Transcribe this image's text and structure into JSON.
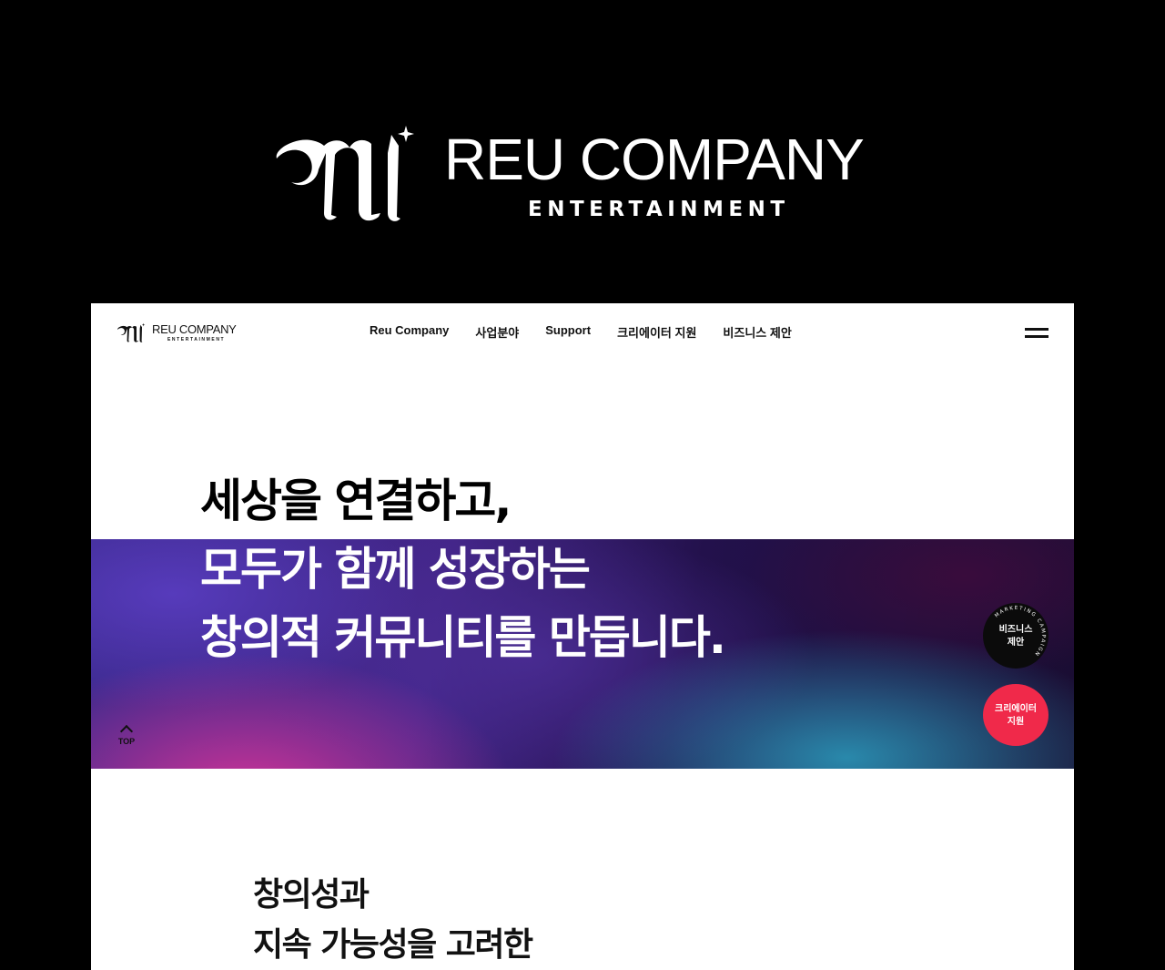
{
  "brand": {
    "monogram": "Rl",
    "name": "REU COMPANY",
    "tagline": "ENTERTAINMENT"
  },
  "nav": {
    "logo": {
      "name": "REU COMPANY",
      "tagline": "ENTERTAINMENT"
    },
    "menu": [
      {
        "label": "Reu Company"
      },
      {
        "label": "사업분야"
      },
      {
        "label": "Support"
      },
      {
        "label": "크리에이터 지원"
      },
      {
        "label": "비즈니스 제안"
      }
    ],
    "menu_icon": "hamburger-icon"
  },
  "hero": {
    "line1": "세상을 연결하고,",
    "line2": "모두가 함께 성장하는",
    "line3": "창의적 커뮤니티를 만듭니다."
  },
  "floating": {
    "business_badge": {
      "label_line1": "비즈니스",
      "label_line2": "제안",
      "ring_text": "MARKETING CAMPAIGN"
    },
    "creator_badge": {
      "label_line1": "크리에이터",
      "label_line2": "지원"
    },
    "top_button": {
      "label": "TOP",
      "icon": "chevron-up-icon"
    }
  },
  "section": {
    "line1": "창의성과",
    "line2": "지속 가능성을 고려한"
  },
  "colors": {
    "accent_red": "#f0294a",
    "badge_dark": "#0b0b0b",
    "gradient_pink": "#d63498",
    "gradient_purple": "#583cbe",
    "gradient_cyan": "#2b9ebe"
  }
}
